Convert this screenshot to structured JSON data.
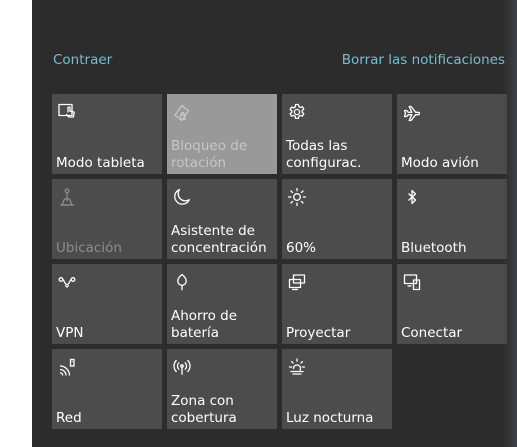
{
  "header": {
    "collapse_label": "Contraer",
    "clear_label": "Borrar las notificaciones"
  },
  "tiles": [
    {
      "label": "Modo tableta",
      "icon": "tablet-mode-icon",
      "state": "normal"
    },
    {
      "label": "Bloqueo de\nrotación",
      "icon": "rotation-lock-icon",
      "state": "active-disabled"
    },
    {
      "label": "Todas las\nconfigurac.",
      "icon": "settings-gear-icon",
      "state": "normal"
    },
    {
      "label": "Modo avión",
      "icon": "airplane-icon",
      "state": "normal"
    },
    {
      "label": "Ubicación",
      "icon": "location-icon",
      "state": "disabled"
    },
    {
      "label": "Asistente de\nconcentración",
      "icon": "moon-icon",
      "state": "normal"
    },
    {
      "label": "60%",
      "icon": "brightness-icon",
      "state": "normal"
    },
    {
      "label": "Bluetooth",
      "icon": "bluetooth-icon",
      "state": "normal"
    },
    {
      "label": "VPN",
      "icon": "vpn-icon",
      "state": "normal"
    },
    {
      "label": "Ahorro de\nbatería",
      "icon": "battery-saver-icon",
      "state": "normal"
    },
    {
      "label": "Proyectar",
      "icon": "project-icon",
      "state": "normal"
    },
    {
      "label": "Conectar",
      "icon": "connect-icon",
      "state": "normal"
    },
    {
      "label": "Red",
      "icon": "network-icon",
      "state": "normal"
    },
    {
      "label": "Zona con\ncobertura",
      "icon": "hotspot-icon",
      "state": "normal"
    },
    {
      "label": "Luz nocturna",
      "icon": "night-light-icon",
      "state": "normal"
    }
  ],
  "colors": {
    "panel_background": "#2c2c2c",
    "tile_background": "#4c4c4c",
    "tile_active_background": "#999999",
    "link_accent": "#76bfce",
    "text": "#ffffff",
    "text_disabled": "#8c8c8c"
  }
}
